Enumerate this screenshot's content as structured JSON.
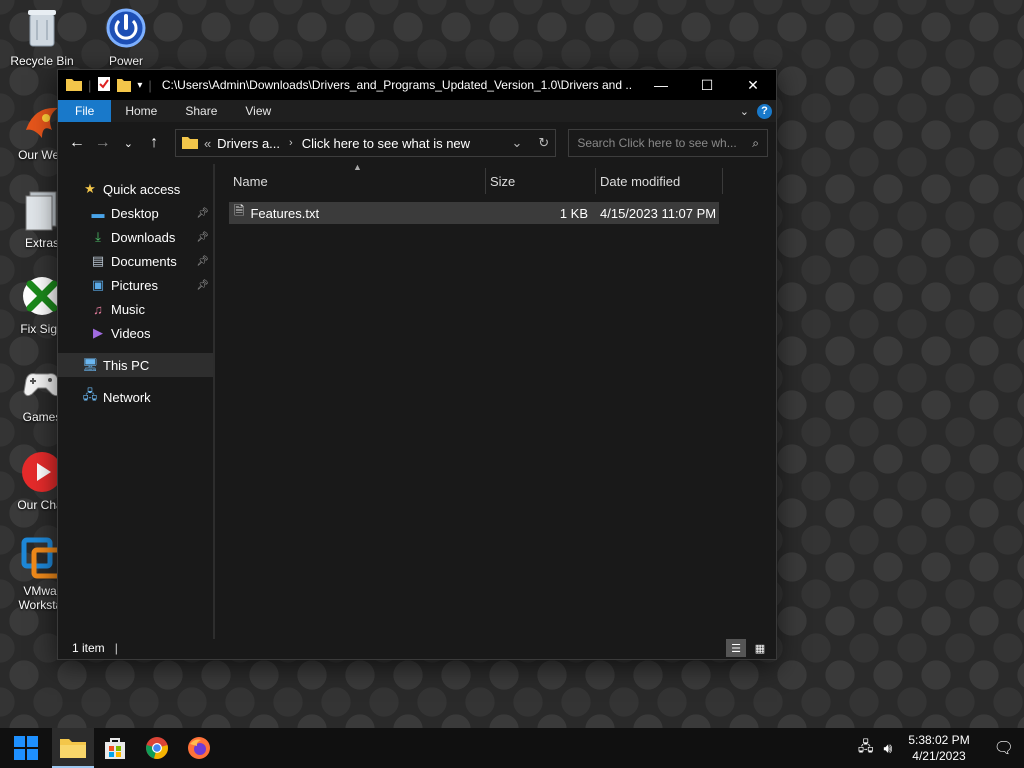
{
  "desktop": {
    "icons": [
      {
        "label": "Recycle Bin",
        "icon": "recycle-bin-icon"
      },
      {
        "label": "Power",
        "icon": "power-icon"
      },
      {
        "label": "Our Web",
        "icon": "phoenix-icon"
      },
      {
        "label": "Extras",
        "icon": "folder-stack-icon"
      },
      {
        "label": "Fix Sign",
        "icon": "xbox-icon"
      },
      {
        "label": "Games",
        "icon": "gamepad-icon"
      },
      {
        "label": "Our Char",
        "icon": "youtube-icon"
      },
      {
        "label": "VMwar",
        "label2": "Workstat",
        "icon": "vmware-icon"
      }
    ]
  },
  "window": {
    "title": "C:\\Users\\Admin\\Downloads\\Drivers_and_Programs_Updated_Version_1.0\\Drivers and ...",
    "controls": {
      "minimize": "—",
      "maximize": "☐",
      "close": "✕"
    },
    "ribbon_tabs": [
      "File",
      "Home",
      "Share",
      "View"
    ],
    "help": "?",
    "address": {
      "overflow": "«",
      "crumbs": [
        "Drivers a...",
        "Click here to see what is new"
      ]
    },
    "search_placeholder": "Search Click here to see wh...",
    "nav_pane": {
      "quick_access": "Quick access",
      "quick_items": [
        {
          "label": "Desktop",
          "pinned": true
        },
        {
          "label": "Downloads",
          "pinned": true
        },
        {
          "label": "Documents",
          "pinned": true
        },
        {
          "label": "Pictures",
          "pinned": true
        },
        {
          "label": "Music",
          "pinned": false
        },
        {
          "label": "Videos",
          "pinned": false
        }
      ],
      "this_pc": "This PC",
      "network": "Network"
    },
    "columns": [
      "Name",
      "Size",
      "Date modified"
    ],
    "files": [
      {
        "name": "Features.txt",
        "size": "1 KB",
        "date": "4/15/2023 11:07 PM"
      }
    ],
    "status": "1 item"
  },
  "taskbar": {
    "time": "5:38:02 PM",
    "date": "4/21/2023"
  },
  "colors": {
    "accent": "#1979ca",
    "window_bg": "#191919",
    "titlebar_bg": "#000000"
  }
}
